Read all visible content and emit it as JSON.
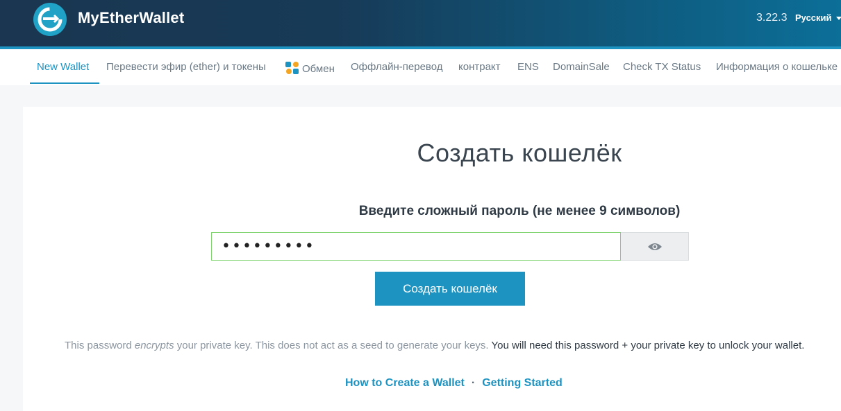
{
  "header": {
    "brand": "MyEtherWallet",
    "version": "3.22.3",
    "language": "Русский"
  },
  "nav": {
    "items": [
      {
        "label": "New Wallet",
        "active": true
      },
      {
        "label": "Перевести эфир (ether) и токены"
      },
      {
        "label": "Обмен",
        "icon": "swap-icon"
      },
      {
        "label": "Оффлайн-перевод"
      },
      {
        "label": "контракт"
      },
      {
        "label": "ENS"
      },
      {
        "label": "DomainSale"
      },
      {
        "label": "Check TX Status"
      },
      {
        "label": "Информация о кошельке"
      }
    ]
  },
  "main": {
    "title": "Создать кошелёк",
    "password_label": "Введите сложный пароль (не менее 9 символов)",
    "password_value": "•••••••••",
    "show_password_icon": "eye-icon",
    "create_button": "Создать кошелёк",
    "note": {
      "part1": "This password ",
      "part2": "encrypts",
      "part3": " your private key. This does not act as a seed to generate your keys.",
      "part4": " You will need this password + your private key to unlock your wallet."
    },
    "links": {
      "how_to": "How to Create a Wallet",
      "separator": "·",
      "getting_started": "Getting Started"
    }
  },
  "colors": {
    "accent": "#1d93c2",
    "header_dark": "#1a3650",
    "input_border": "#7ed36e"
  }
}
